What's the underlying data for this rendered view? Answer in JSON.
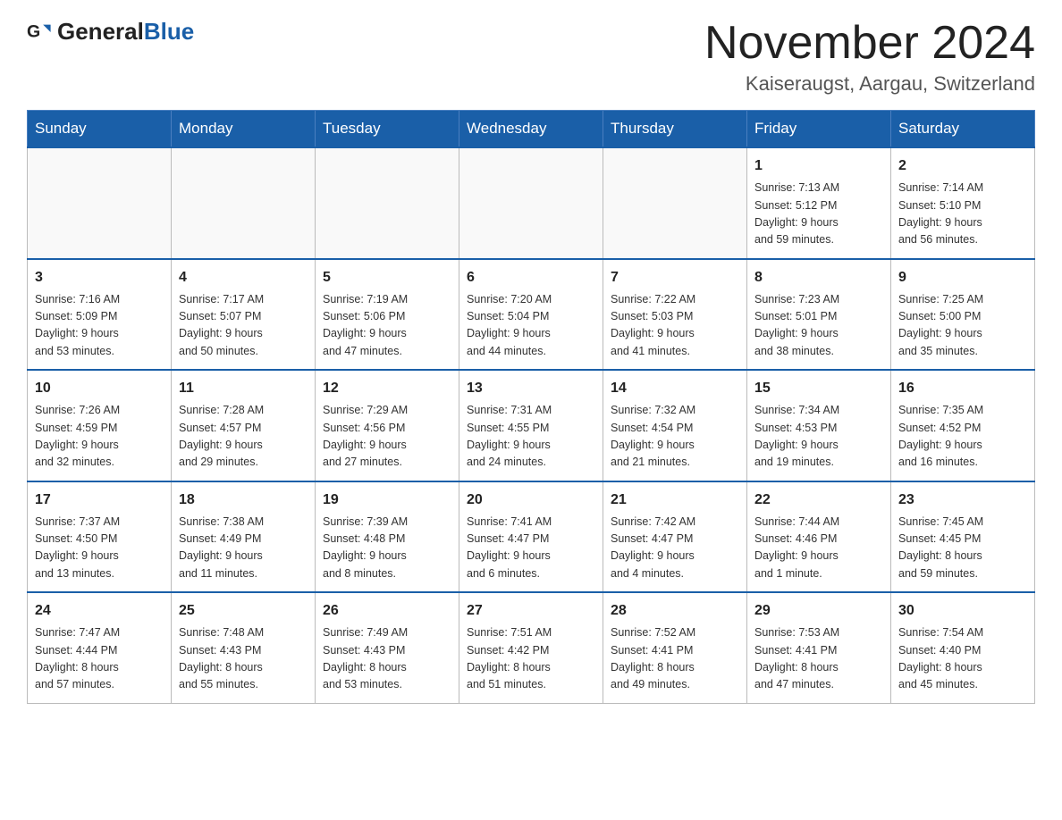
{
  "logo": {
    "text_general": "General",
    "text_blue": "Blue"
  },
  "header": {
    "month_year": "November 2024",
    "location": "Kaiseraugst, Aargau, Switzerland"
  },
  "weekdays": [
    "Sunday",
    "Monday",
    "Tuesday",
    "Wednesday",
    "Thursday",
    "Friday",
    "Saturday"
  ],
  "weeks": [
    [
      {
        "day": "",
        "info": ""
      },
      {
        "day": "",
        "info": ""
      },
      {
        "day": "",
        "info": ""
      },
      {
        "day": "",
        "info": ""
      },
      {
        "day": "",
        "info": ""
      },
      {
        "day": "1",
        "info": "Sunrise: 7:13 AM\nSunset: 5:12 PM\nDaylight: 9 hours\nand 59 minutes."
      },
      {
        "day": "2",
        "info": "Sunrise: 7:14 AM\nSunset: 5:10 PM\nDaylight: 9 hours\nand 56 minutes."
      }
    ],
    [
      {
        "day": "3",
        "info": "Sunrise: 7:16 AM\nSunset: 5:09 PM\nDaylight: 9 hours\nand 53 minutes."
      },
      {
        "day": "4",
        "info": "Sunrise: 7:17 AM\nSunset: 5:07 PM\nDaylight: 9 hours\nand 50 minutes."
      },
      {
        "day": "5",
        "info": "Sunrise: 7:19 AM\nSunset: 5:06 PM\nDaylight: 9 hours\nand 47 minutes."
      },
      {
        "day": "6",
        "info": "Sunrise: 7:20 AM\nSunset: 5:04 PM\nDaylight: 9 hours\nand 44 minutes."
      },
      {
        "day": "7",
        "info": "Sunrise: 7:22 AM\nSunset: 5:03 PM\nDaylight: 9 hours\nand 41 minutes."
      },
      {
        "day": "8",
        "info": "Sunrise: 7:23 AM\nSunset: 5:01 PM\nDaylight: 9 hours\nand 38 minutes."
      },
      {
        "day": "9",
        "info": "Sunrise: 7:25 AM\nSunset: 5:00 PM\nDaylight: 9 hours\nand 35 minutes."
      }
    ],
    [
      {
        "day": "10",
        "info": "Sunrise: 7:26 AM\nSunset: 4:59 PM\nDaylight: 9 hours\nand 32 minutes."
      },
      {
        "day": "11",
        "info": "Sunrise: 7:28 AM\nSunset: 4:57 PM\nDaylight: 9 hours\nand 29 minutes."
      },
      {
        "day": "12",
        "info": "Sunrise: 7:29 AM\nSunset: 4:56 PM\nDaylight: 9 hours\nand 27 minutes."
      },
      {
        "day": "13",
        "info": "Sunrise: 7:31 AM\nSunset: 4:55 PM\nDaylight: 9 hours\nand 24 minutes."
      },
      {
        "day": "14",
        "info": "Sunrise: 7:32 AM\nSunset: 4:54 PM\nDaylight: 9 hours\nand 21 minutes."
      },
      {
        "day": "15",
        "info": "Sunrise: 7:34 AM\nSunset: 4:53 PM\nDaylight: 9 hours\nand 19 minutes."
      },
      {
        "day": "16",
        "info": "Sunrise: 7:35 AM\nSunset: 4:52 PM\nDaylight: 9 hours\nand 16 minutes."
      }
    ],
    [
      {
        "day": "17",
        "info": "Sunrise: 7:37 AM\nSunset: 4:50 PM\nDaylight: 9 hours\nand 13 minutes."
      },
      {
        "day": "18",
        "info": "Sunrise: 7:38 AM\nSunset: 4:49 PM\nDaylight: 9 hours\nand 11 minutes."
      },
      {
        "day": "19",
        "info": "Sunrise: 7:39 AM\nSunset: 4:48 PM\nDaylight: 9 hours\nand 8 minutes."
      },
      {
        "day": "20",
        "info": "Sunrise: 7:41 AM\nSunset: 4:47 PM\nDaylight: 9 hours\nand 6 minutes."
      },
      {
        "day": "21",
        "info": "Sunrise: 7:42 AM\nSunset: 4:47 PM\nDaylight: 9 hours\nand 4 minutes."
      },
      {
        "day": "22",
        "info": "Sunrise: 7:44 AM\nSunset: 4:46 PM\nDaylight: 9 hours\nand 1 minute."
      },
      {
        "day": "23",
        "info": "Sunrise: 7:45 AM\nSunset: 4:45 PM\nDaylight: 8 hours\nand 59 minutes."
      }
    ],
    [
      {
        "day": "24",
        "info": "Sunrise: 7:47 AM\nSunset: 4:44 PM\nDaylight: 8 hours\nand 57 minutes."
      },
      {
        "day": "25",
        "info": "Sunrise: 7:48 AM\nSunset: 4:43 PM\nDaylight: 8 hours\nand 55 minutes."
      },
      {
        "day": "26",
        "info": "Sunrise: 7:49 AM\nSunset: 4:43 PM\nDaylight: 8 hours\nand 53 minutes."
      },
      {
        "day": "27",
        "info": "Sunrise: 7:51 AM\nSunset: 4:42 PM\nDaylight: 8 hours\nand 51 minutes."
      },
      {
        "day": "28",
        "info": "Sunrise: 7:52 AM\nSunset: 4:41 PM\nDaylight: 8 hours\nand 49 minutes."
      },
      {
        "day": "29",
        "info": "Sunrise: 7:53 AM\nSunset: 4:41 PM\nDaylight: 8 hours\nand 47 minutes."
      },
      {
        "day": "30",
        "info": "Sunrise: 7:54 AM\nSunset: 4:40 PM\nDaylight: 8 hours\nand 45 minutes."
      }
    ]
  ]
}
